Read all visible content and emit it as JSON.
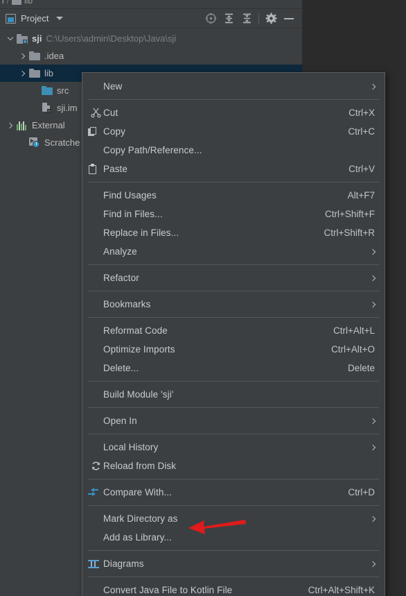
{
  "window": {
    "background_color": "#2b2b2b",
    "panel_color": "#3c3f41",
    "accent_color": "#3592c4",
    "selection_color": "#0d293e"
  },
  "breadcrumb": {
    "project_fragment": "i",
    "separator": "/",
    "folder_label": "lib"
  },
  "tool_window": {
    "title": "Project",
    "icon": "project-icon",
    "actions": [
      {
        "name": "select-opened-file-icon",
        "label": "Select Opened File"
      },
      {
        "name": "expand-all-icon",
        "label": "Expand All"
      },
      {
        "name": "collapse-all-icon",
        "label": "Collapse All"
      },
      {
        "name": "settings-gear-icon",
        "label": "Options"
      },
      {
        "name": "hide-icon",
        "label": "Hide"
      }
    ]
  },
  "tree": {
    "nodes": [
      {
        "arrow": "down",
        "icon": "module-icon",
        "name": "sji",
        "bold": true,
        "path": "C:\\Users\\admin\\Desktop\\Java\\sji",
        "indent": 1,
        "selected": false
      },
      {
        "arrow": "right",
        "icon": "folder-icon",
        "name": ".idea",
        "bold": false,
        "path": "",
        "indent": 2,
        "selected": false
      },
      {
        "arrow": "right",
        "icon": "folder-icon",
        "name": "lib",
        "bold": false,
        "path": "",
        "indent": 2,
        "selected": true
      },
      {
        "arrow": "none",
        "icon": "source-folder-icon",
        "name": "src",
        "bold": false,
        "path": "",
        "indent": 3,
        "selected": false
      },
      {
        "arrow": "none",
        "icon": "iml-file-icon",
        "name": "sji.im",
        "bold": false,
        "path": "",
        "indent": 3,
        "selected": false
      },
      {
        "arrow": "right",
        "icon": "external-libraries-icon",
        "name": "External",
        "bold": false,
        "path": "",
        "indent": 1,
        "selected": false
      },
      {
        "arrow": "none",
        "icon": "scratches-icon",
        "name": "Scratche",
        "bold": false,
        "path": "",
        "indent": 2,
        "selected": false
      }
    ]
  },
  "context_menu": {
    "groups": [
      {
        "items": [
          {
            "label": "New",
            "shortcut": "",
            "icon": "",
            "submenu": true
          }
        ]
      },
      {
        "items": [
          {
            "label": "Cut",
            "shortcut": "Ctrl+X",
            "icon": "scissors-icon",
            "submenu": false,
            "mnemonic_index": 2
          },
          {
            "label": "Copy",
            "shortcut": "Ctrl+C",
            "icon": "copy-icon",
            "submenu": false,
            "mnemonic_index": 0
          },
          {
            "label": "Copy Path/Reference...",
            "shortcut": "",
            "icon": "",
            "submenu": false
          },
          {
            "label": "Paste",
            "shortcut": "Ctrl+V",
            "icon": "paste-icon",
            "submenu": false,
            "mnemonic_index": 0
          }
        ]
      },
      {
        "items": [
          {
            "label": "Find Usages",
            "shortcut": "Alt+F7",
            "icon": "",
            "submenu": false,
            "mnemonic_index": 5
          },
          {
            "label": "Find in Files...",
            "shortcut": "Ctrl+Shift+F",
            "icon": "",
            "submenu": false
          },
          {
            "label": "Replace in Files...",
            "shortcut": "Ctrl+Shift+R",
            "icon": "",
            "submenu": false,
            "mnemonic_index": 4
          },
          {
            "label": "Analyze",
            "shortcut": "",
            "icon": "",
            "submenu": true,
            "mnemonic_index": 5
          }
        ]
      },
      {
        "items": [
          {
            "label": "Refactor",
            "shortcut": "",
            "icon": "",
            "submenu": true,
            "mnemonic_index": 0
          }
        ]
      },
      {
        "items": [
          {
            "label": "Bookmarks",
            "shortcut": "",
            "icon": "",
            "submenu": true
          }
        ]
      },
      {
        "items": [
          {
            "label": "Reformat Code",
            "shortcut": "Ctrl+Alt+L",
            "icon": "",
            "submenu": false,
            "mnemonic_index": 0
          },
          {
            "label": "Optimize Imports",
            "shortcut": "Ctrl+Alt+O",
            "icon": "",
            "submenu": false,
            "mnemonic_index": 7
          },
          {
            "label": "Delete...",
            "shortcut": "Delete",
            "icon": "",
            "submenu": false,
            "mnemonic_index": 0
          }
        ]
      },
      {
        "items": [
          {
            "label": "Build Module 'sji'",
            "shortcut": "",
            "icon": "",
            "submenu": false,
            "mnemonic_index": 6
          }
        ]
      },
      {
        "items": [
          {
            "label": "Open In",
            "shortcut": "",
            "icon": "",
            "submenu": true
          }
        ]
      },
      {
        "items": [
          {
            "label": "Local History",
            "shortcut": "",
            "icon": "",
            "submenu": true,
            "mnemonic_index": 6
          },
          {
            "label": "Reload from Disk",
            "shortcut": "",
            "icon": "reload-icon",
            "submenu": false
          }
        ]
      },
      {
        "items": [
          {
            "label": "Compare With...",
            "shortcut": "Ctrl+D",
            "icon": "compare-icon",
            "submenu": false
          }
        ]
      },
      {
        "items": [
          {
            "label": "Mark Directory as",
            "shortcut": "",
            "icon": "",
            "submenu": true
          },
          {
            "label": "Add as Library...",
            "shortcut": "",
            "icon": "",
            "submenu": false
          }
        ]
      },
      {
        "items": [
          {
            "label": "Diagrams",
            "shortcut": "",
            "icon": "diagram-icon",
            "submenu": true
          }
        ]
      },
      {
        "items": [
          {
            "label": "Convert Java File to Kotlin File",
            "shortcut": "Ctrl+Alt+Shift+K",
            "icon": "",
            "submenu": false
          }
        ]
      }
    ]
  },
  "annotation": {
    "arrow_color": "#e01b1b",
    "points_to": "Add as Library..."
  }
}
